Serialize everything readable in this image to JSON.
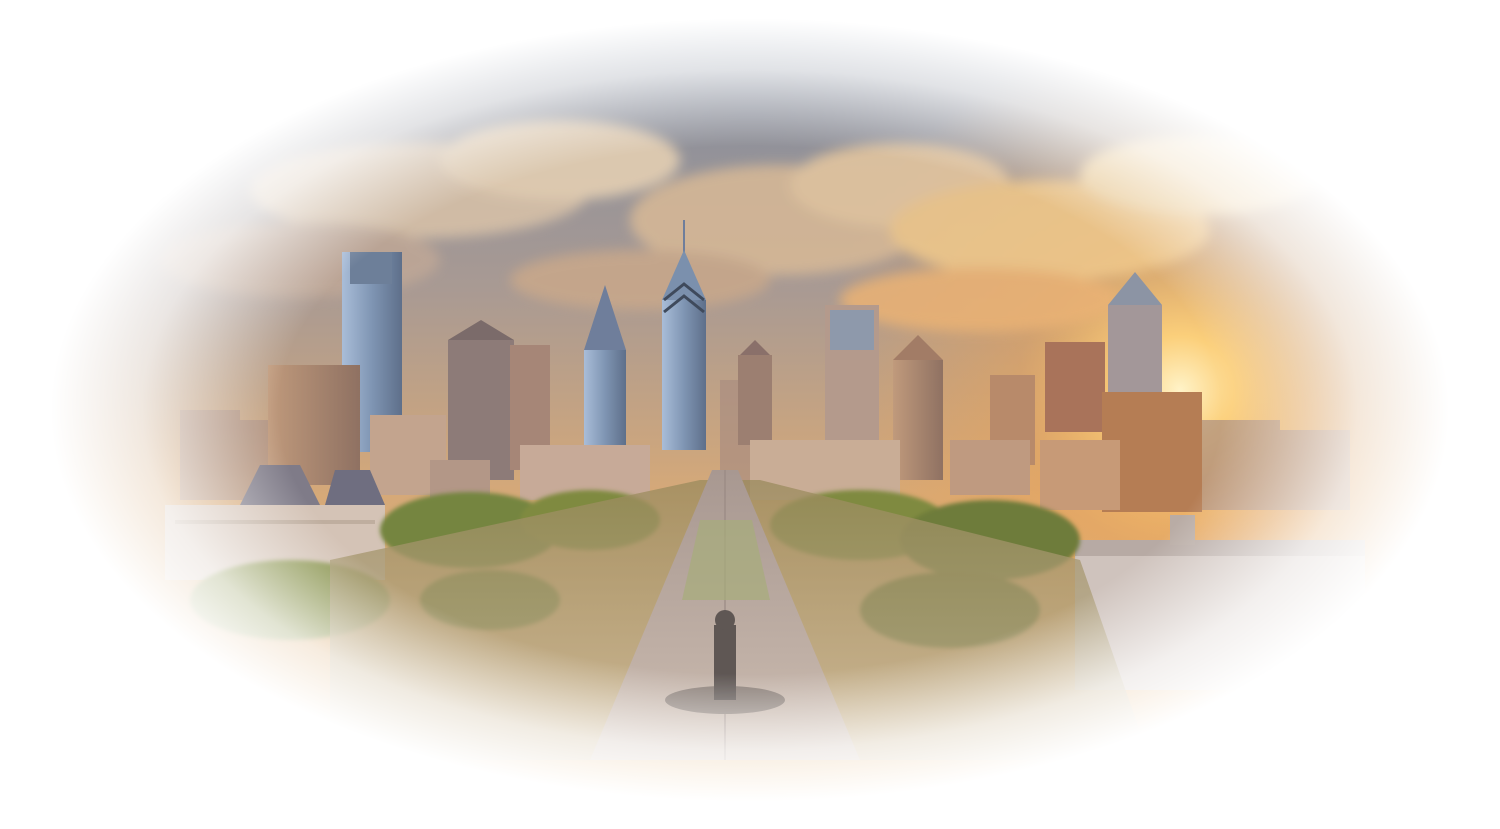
{
  "scene": {
    "subject": "city-skyline",
    "colors": {
      "sky_top": "#6f7f95",
      "sky_mid": "#b79a86",
      "sun": "#ffc766",
      "glow": "#f6b25c",
      "tower_glass": "#8ea3bf",
      "tower_warm": "#b98d6b",
      "tower_shadow": "#6f6161",
      "tree": "#7f8a3f",
      "tree_dark": "#5a6633",
      "avenue": "#b9a79a",
      "vignette": "#ffffff"
    }
  }
}
